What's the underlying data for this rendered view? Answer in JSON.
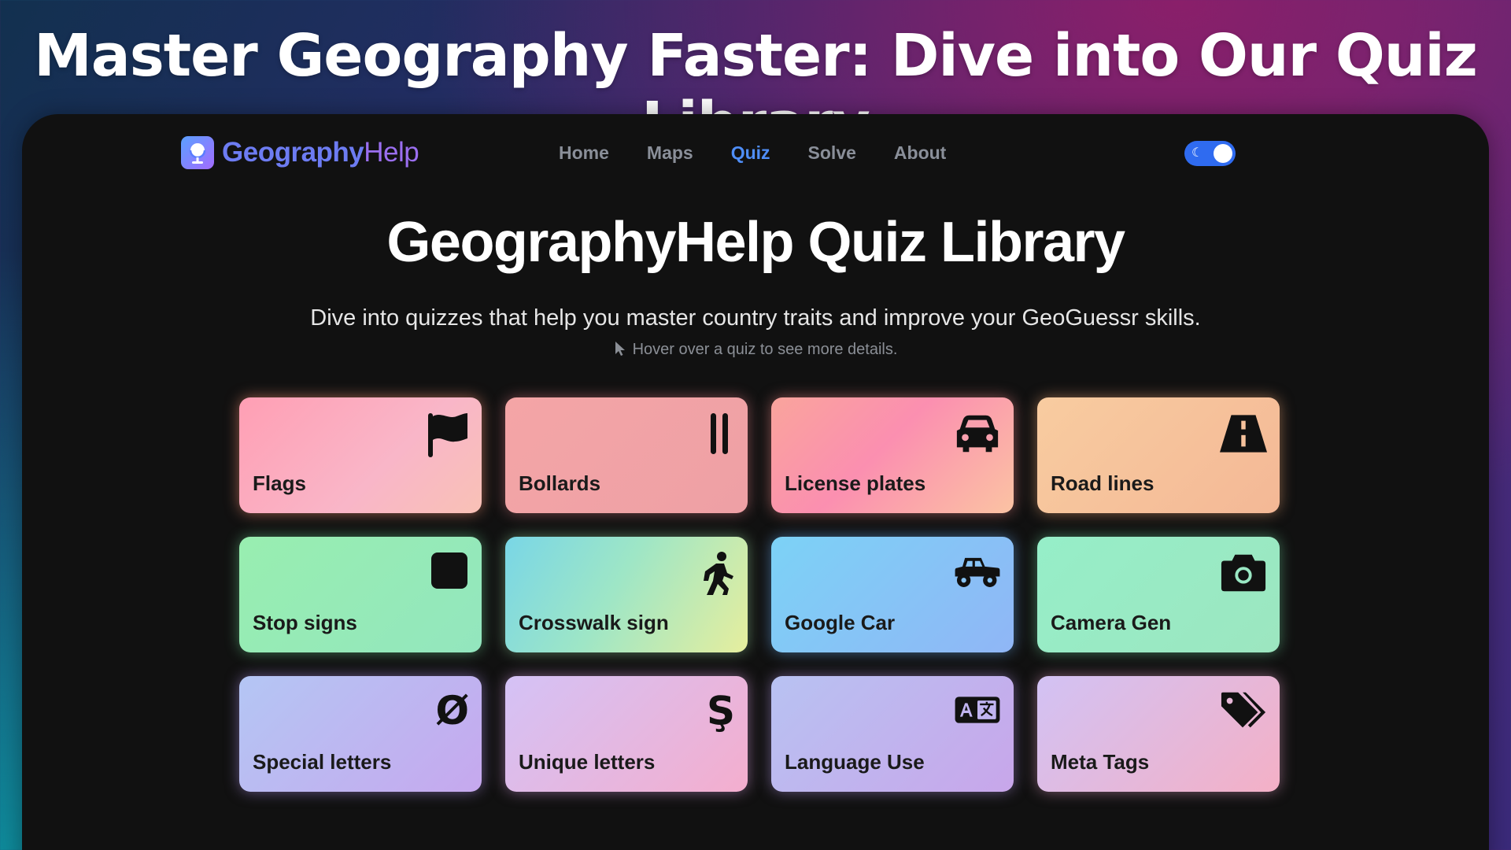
{
  "banner": {
    "title": "Master Geography Faster: Dive into Our Quiz Library"
  },
  "navbar": {
    "logo": {
      "part1": "Geography",
      "part2": "Help",
      "icon": "globe-icon"
    },
    "links": [
      {
        "label": "Home",
        "active": false
      },
      {
        "label": "Maps",
        "active": false
      },
      {
        "label": "Quiz",
        "active": true
      },
      {
        "label": "Solve",
        "active": false
      },
      {
        "label": "About",
        "active": false
      }
    ],
    "theme_toggle": {
      "state": "dark",
      "icon": "moon-icon"
    }
  },
  "main": {
    "title": "GeographyHelp Quiz Library",
    "subtitle": "Dive into quizzes that help you master country traits and improve your GeoGuessr skills.",
    "hint": "Hover over a quiz to see more details.",
    "cards": [
      {
        "label": "Flags",
        "icon": "flag-icon"
      },
      {
        "label": "Bollards",
        "icon": "bollard-icon"
      },
      {
        "label": "License plates",
        "icon": "car-icon"
      },
      {
        "label": "Road lines",
        "icon": "road-icon"
      },
      {
        "label": "Stop signs",
        "icon": "square-icon"
      },
      {
        "label": "Crosswalk sign",
        "icon": "pedestrian-icon"
      },
      {
        "label": "Google Car",
        "icon": "truck-icon"
      },
      {
        "label": "Camera Gen",
        "icon": "camera-icon"
      },
      {
        "label": "Special letters",
        "icon": "o-slash-icon",
        "glyph": "Ø"
      },
      {
        "label": "Unique letters",
        "icon": "s-cedilla-icon",
        "glyph": "Ş"
      },
      {
        "label": "Language Use",
        "icon": "language-icon"
      },
      {
        "label": "Meta Tags",
        "icon": "tags-icon"
      }
    ]
  }
}
